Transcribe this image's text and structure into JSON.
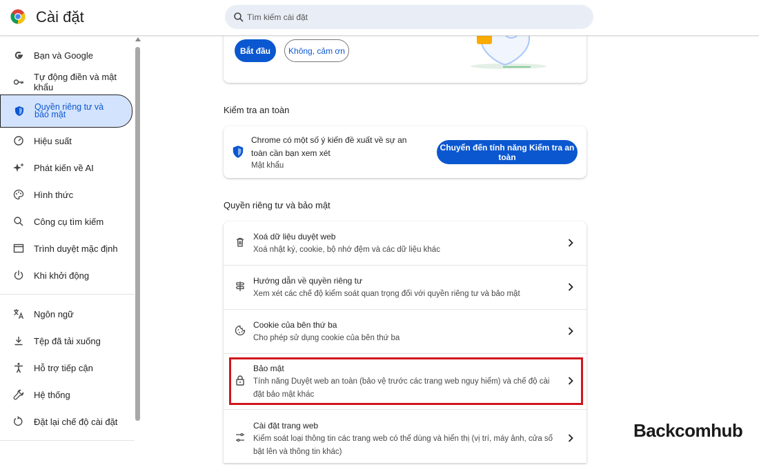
{
  "app": {
    "title": "Cài đặt"
  },
  "search": {
    "placeholder": "Tìm kiếm cài đặt"
  },
  "sidebar": {
    "items": [
      {
        "label": "Bạn và Google"
      },
      {
        "label": "Tự động điền và mật khẩu"
      },
      {
        "label": "Quyền riêng tư và bảo mật"
      },
      {
        "label": "Hiệu suất"
      },
      {
        "label": "Phát kiến về AI"
      },
      {
        "label": "Hình thức"
      },
      {
        "label": "Công cụ tìm kiếm"
      },
      {
        "label": "Trình duyệt mặc định"
      },
      {
        "label": "Khi khởi động"
      },
      {
        "label": "Ngôn ngữ"
      },
      {
        "label": "Tệp đã tải xuống"
      },
      {
        "label": "Hỗ trợ tiếp cận"
      },
      {
        "label": "Hệ thống"
      },
      {
        "label": "Đặt lại chế độ cài đặt"
      }
    ]
  },
  "promo": {
    "start_label": "Bắt đầu",
    "decline_label": "Không, cảm ơn"
  },
  "safety_check": {
    "section_title": "Kiểm tra an toàn",
    "message": "Chrome có một số ý kiến đề xuất về sự an toàn cần bạn xem xét",
    "sub": "Mật khẩu",
    "button_label": "Chuyển đến tính năng Kiểm tra an toàn"
  },
  "privacy": {
    "section_title": "Quyền riêng tư và bảo mật",
    "rows": [
      {
        "title": "Xoá dữ liệu duyệt web",
        "desc": "Xoá nhật ký, cookie, bộ nhớ đệm và các dữ liệu khác",
        "icon": "trash-icon"
      },
      {
        "title": "Hướng dẫn về quyền riêng tư",
        "desc": "Xem xét các chế độ kiểm soát quan trọng đối với quyền riêng tư và bảo mật",
        "icon": "signpost-icon"
      },
      {
        "title": "Cookie của bên thứ ba",
        "desc": "Cho phép sử dụng cookie của bên thứ ba",
        "icon": "cookie-icon"
      },
      {
        "title": "Bảo mật",
        "desc": "Tính năng Duyệt web an toàn (bảo vệ trước các trang web nguy hiểm) và chế độ cài đặt bảo mật khác",
        "icon": "lock-icon"
      },
      {
        "title": "Cài đặt trang web",
        "desc": "Kiểm soát loại thông tin các trang web có thể dùng và hiển thị (vị trí, máy ảnh, cửa sổ bật lên và thông tin khác)",
        "icon": "tune-icon"
      }
    ]
  },
  "watermark": "Backcomhub",
  "colors": {
    "accent": "#0b57d0",
    "active_bg": "#d3e3fd",
    "highlight": "#d0151c"
  }
}
